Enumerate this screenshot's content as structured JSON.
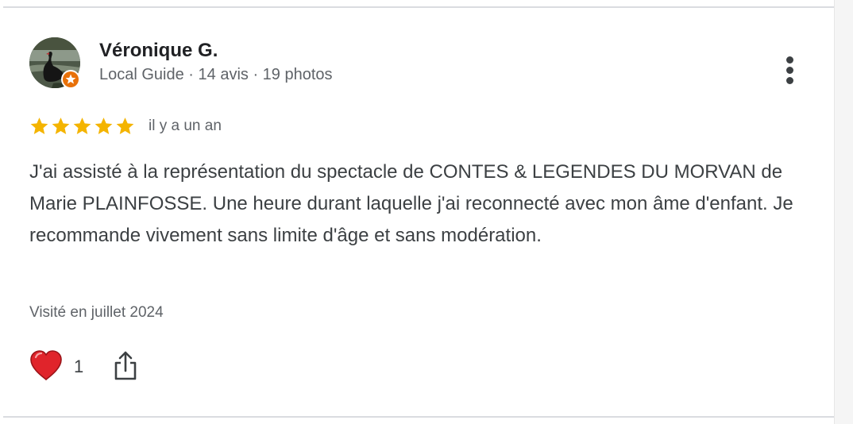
{
  "review": {
    "reviewer": {
      "name": "Véronique G.",
      "meta": "Local Guide · 14 avis · 19 photos",
      "avatar_icon": "black-swan-photo",
      "badge_icon": "local-guide-star-badge"
    },
    "rating": {
      "stars": 5,
      "max_stars": 5,
      "star_color": "#F4B400"
    },
    "date": "il y a un an",
    "text": "J'ai assisté à la représentation du spectacle de CONTES & LEGENDES DU MORVAN de Marie PLAINFOSSE. Une heure durant laquelle j'ai reconnecté avec mon âme d'enfant. Je recommande vivement sans limite d'âge et sans modération.",
    "visit": "Visité en juillet 2024",
    "reactions": {
      "icon": "heart-icon",
      "count": "1",
      "color": "#E0242B"
    },
    "actions": {
      "share_icon": "share-icon",
      "more_icon": "more-vertical-icon"
    }
  }
}
